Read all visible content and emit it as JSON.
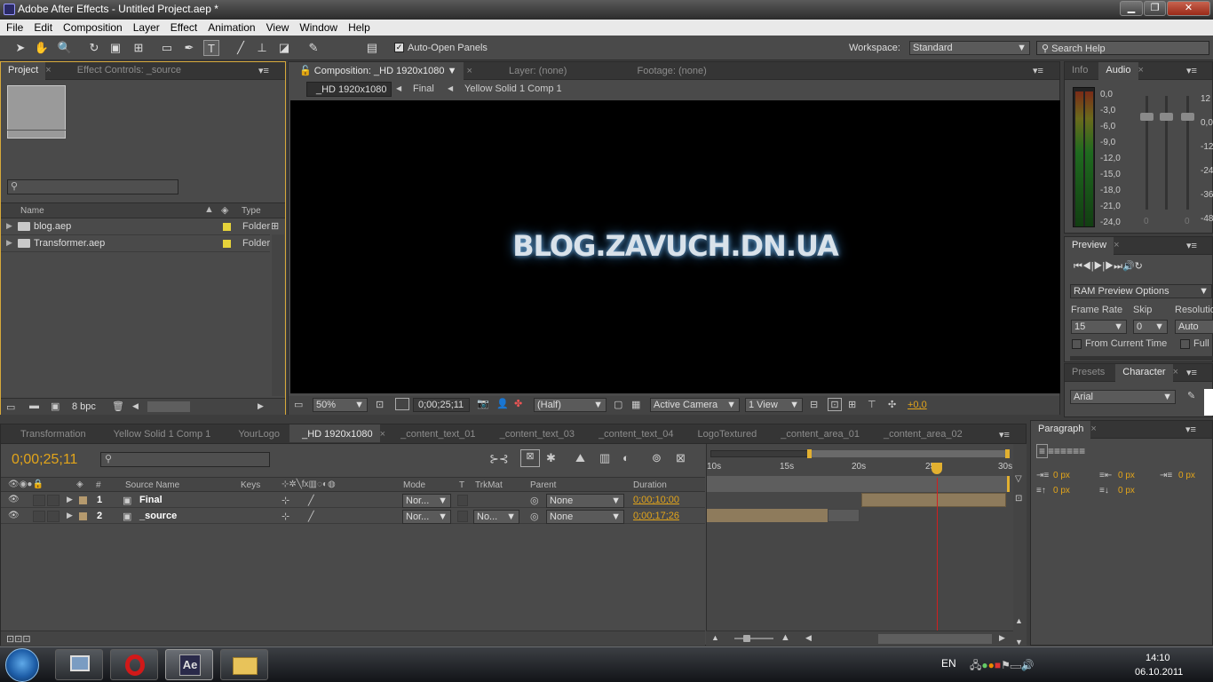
{
  "window": {
    "title": "Adobe After Effects - Untitled Project.aep *",
    "min": "▁",
    "max": "❐",
    "close": "✕"
  },
  "menu": [
    "File",
    "Edit",
    "Composition",
    "Layer",
    "Effect",
    "Animation",
    "View",
    "Window",
    "Help"
  ],
  "toolbar": {
    "auto_open_label": "Auto-Open Panels",
    "workspace_label": "Workspace:",
    "workspace_value": "Standard",
    "search_placeholder": "Search Help"
  },
  "project": {
    "tabs": [
      "Project",
      "Effect Controls: _source"
    ],
    "columns": {
      "name": "Name",
      "type": "Type"
    },
    "items": [
      {
        "name": "blog.aep",
        "type": "Folder"
      },
      {
        "name": "Transformer.aep",
        "type": "Folder"
      }
    ],
    "bpc": "8 bpc"
  },
  "comp": {
    "tabs": [
      "Composition: _HD 1920x1080",
      "Layer: (none)",
      "Footage: (none)"
    ],
    "breadcrumbs": [
      "_HD 1920x1080",
      "Final",
      "Yellow Solid 1 Comp 1"
    ],
    "viewer_text": "BLOG.ZAVUCH.DN.UA",
    "zoom": "50%",
    "timecode": "0;00;25;11",
    "resolution": "(Half)",
    "camera": "Active Camera",
    "views": "1 View",
    "exposure": "+0,0"
  },
  "info": {
    "tabs": [
      "Info",
      "Audio"
    ],
    "db_left": [
      "0,0",
      "-3,0",
      "-6,0",
      "-9,0",
      "-12,0",
      "-15,0",
      "-18,0",
      "-21,0",
      "-24,0"
    ],
    "db_right": [
      "12",
      "0,0",
      "-12",
      "-24",
      "-36",
      "-48"
    ],
    "slider_values": [
      "0",
      "0"
    ]
  },
  "preview": {
    "tab": "Preview",
    "options": "RAM Preview Options",
    "frame_rate_label": "Frame Rate",
    "frame_rate": "15",
    "skip_label": "Skip",
    "skip": "0",
    "resolution_label": "Resolution",
    "resolution": "Auto",
    "from_current": "From Current Time",
    "full": "Full"
  },
  "character": {
    "tabs": [
      "Presets",
      "Character"
    ],
    "font": "Arial"
  },
  "paragraph": {
    "tab": "Paragraph",
    "values": [
      "0 px",
      "0 px",
      "0 px",
      "0 px",
      "0 px"
    ]
  },
  "timeline": {
    "tabs": [
      "Transformation",
      "Yellow Solid 1 Comp 1",
      "YourLogo",
      "_HD 1920x1080",
      "_content_text_01",
      "_content_text_03",
      "_content_text_04",
      "LogoTextured",
      "_content_area_01",
      "_content_area_02"
    ],
    "current_time": "0;00;25;11",
    "columns": {
      "num": "#",
      "source": "Source Name",
      "keys": "Keys",
      "mode": "Mode",
      "t": "T",
      "trkmat": "TrkMat",
      "parent": "Parent",
      "duration": "Duration"
    },
    "ruler": [
      "10s",
      "15s",
      "20s",
      "25s",
      "30s"
    ],
    "layers": [
      {
        "num": "1",
        "name": "Final",
        "mode": "Nor...",
        "trkmat": "",
        "parent": "None",
        "duration": "0;00;10;00"
      },
      {
        "num": "2",
        "name": "_source",
        "mode": "Nor...",
        "trkmat": "No...",
        "parent": "None",
        "duration": "0;00;17;26"
      }
    ]
  },
  "taskbar": {
    "lang": "EN",
    "time": "14:10",
    "date": "06.10.2011",
    "ae": "Ae"
  }
}
